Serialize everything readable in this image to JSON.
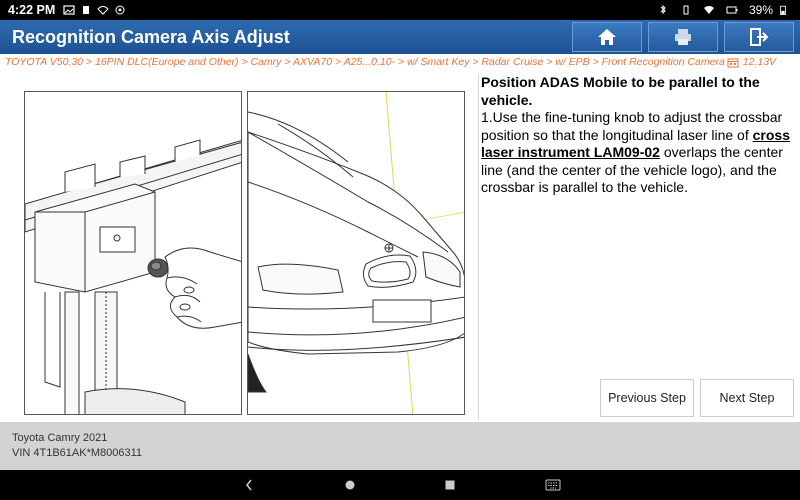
{
  "status": {
    "time": "4:22 PM",
    "battery": "39%"
  },
  "header": {
    "title": "Recognition Camera Axis Adjust"
  },
  "breadcrumb": {
    "path": "TOYOTA V50.30 > 16PIN DLC(Europe and Other) > Camry > AXVA70 > A25...0.10- > w/ Smart Key > Radar Cruise > w/ EPB > Front Recognition Camera",
    "voltage": "12.13V"
  },
  "instruction": {
    "heading": "Position ADAS Mobile to be parallel to the vehicle.",
    "step_prefix": "1.Use the fine-tuning knob to adjust the crossbar position so that the longitudinal laser line of ",
    "tool": "cross laser instrument LAM09-02",
    "step_suffix": " overlaps the center line (and the center of the vehicle logo), and the crossbar is parallel to the vehicle."
  },
  "buttons": {
    "previous": "Previous Step",
    "next": "Next Step"
  },
  "vehicle": {
    "model": "Toyota Camry 2021",
    "vin": "VIN 4T1B61AK*M8006311"
  },
  "icons": {
    "home": "home-icon",
    "print": "print-icon",
    "exit": "exit-icon",
    "calendar": "calendar-icon"
  },
  "colors": {
    "header": "#245a9c",
    "breadcrumb": "#e8743b",
    "footer": "#d3d3d3"
  }
}
